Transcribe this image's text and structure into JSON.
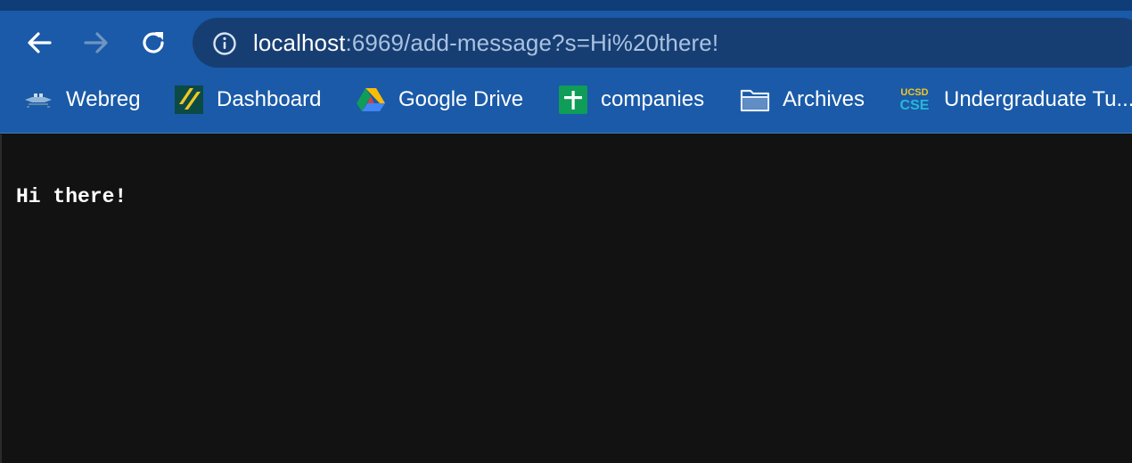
{
  "browser": {
    "url": {
      "host": "localhost",
      "rest": ":6969/add-message?s=Hi%20there!"
    },
    "bookmarks": [
      {
        "label": "Webreg",
        "icon": "webreg-icon"
      },
      {
        "label": "Dashboard",
        "icon": "dashboard-icon"
      },
      {
        "label": "Google Drive",
        "icon": "google-drive-icon"
      },
      {
        "label": "companies",
        "icon": "google-sheets-icon"
      },
      {
        "label": "Archives",
        "icon": "folder-icon"
      },
      {
        "label": "Undergraduate Tu...",
        "icon": "ucsd-cse-icon",
        "icon_text_top": "UCSD",
        "icon_text_bottom": "CSE"
      }
    ],
    "colors": {
      "toolbar": "#1a5aa8",
      "omnibox": "#173e72",
      "page_background": "#121212"
    }
  },
  "page": {
    "message": "Hi there!"
  }
}
